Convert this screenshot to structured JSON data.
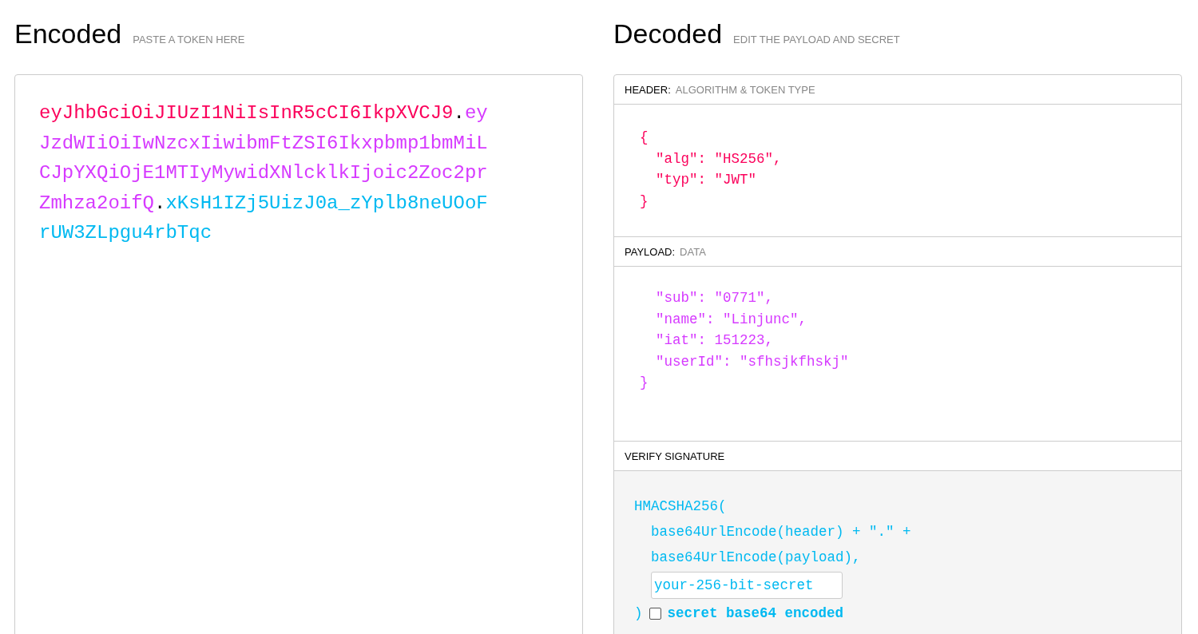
{
  "encoded": {
    "title": "Encoded",
    "subtitle": "PASTE A TOKEN HERE",
    "token": [
      {
        "kind": "header",
        "text": "eyJhbGciOiJIUzI1NiIsInR5cCI6IkpXVCJ9"
      },
      {
        "kind": "dot",
        "text": "."
      },
      {
        "kind": "payload",
        "text": "eyJzdWIiOiIwNzcxIiwibmFtZSI6Ikxpbmp1bmMiLCJpYXQiOjE1MTIyMywidXNlcklkIjoic2Zoc2prZmhza2oifQ"
      },
      {
        "kind": "dot",
        "text": "."
      },
      {
        "kind": "signature",
        "text": "xKsH1IZj5UizJ0a_zYplb8neUOoFrUW3ZLpgu4rbTqc"
      }
    ]
  },
  "decoded": {
    "title": "Decoded",
    "subtitle": "EDIT THE PAYLOAD AND SECRET",
    "header": {
      "label": "HEADER:",
      "hint": "ALGORITHM & TOKEN TYPE",
      "lines": [
        {
          "kind": "brace",
          "text": "{"
        },
        {
          "kind": "member",
          "text": "\"alg\": \"HS256\","
        },
        {
          "kind": "member",
          "text": "\"typ\": \"JWT\""
        },
        {
          "kind": "brace",
          "text": "}"
        }
      ]
    },
    "payload": {
      "label": "PAYLOAD:",
      "hint": "DATA",
      "lines": [
        {
          "kind": "member",
          "text": "\"sub\": \"0771\","
        },
        {
          "kind": "member",
          "text": "\"name\": \"Linjunc\","
        },
        {
          "kind": "member",
          "text": "\"iat\": 151223,"
        },
        {
          "kind": "member",
          "text": "\"userId\": \"sfhsjkfhskj\""
        },
        {
          "kind": "brace",
          "text": "}"
        }
      ]
    },
    "verify": {
      "label": "VERIFY SIGNATURE",
      "open": "HMACSHA256(",
      "args": [
        "base64UrlEncode(header) + \".\" +",
        "base64UrlEncode(payload),"
      ],
      "secret": "your-256-bit-secret",
      "close": ")",
      "base64": {
        "label": "secret base64 encoded",
        "checked": false
      }
    }
  }
}
